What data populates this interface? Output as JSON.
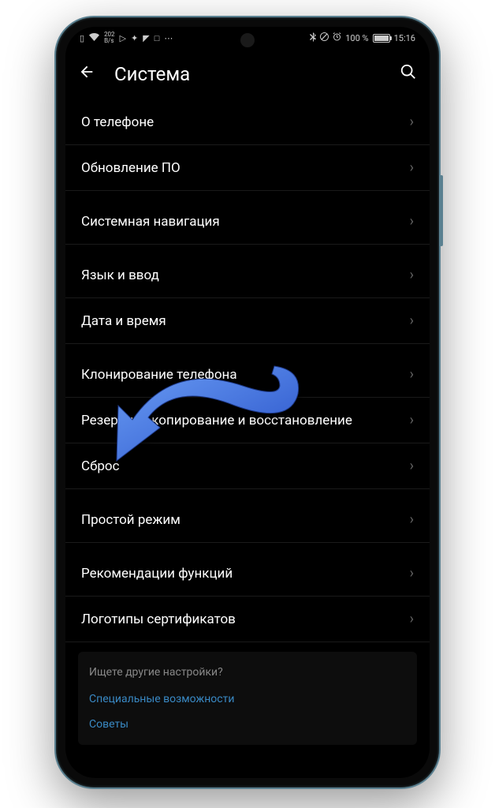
{
  "status_bar": {
    "speed": "202",
    "speed_unit": "B/s",
    "battery_percent": "100 %",
    "time": "15:16"
  },
  "header": {
    "title": "Система"
  },
  "sections": [
    {
      "items": [
        {
          "label": "О телефоне"
        },
        {
          "label": "Обновление ПО"
        }
      ]
    },
    {
      "items": [
        {
          "label": "Системная навигация"
        }
      ]
    },
    {
      "items": [
        {
          "label": "Язык и ввод"
        },
        {
          "label": "Дата и время"
        }
      ]
    },
    {
      "items": [
        {
          "label": "Клонирование телефона"
        },
        {
          "label": "Резервное копирование и восстановление"
        },
        {
          "label": "Сброс"
        }
      ]
    },
    {
      "items": [
        {
          "label": "Простой режим"
        }
      ]
    },
    {
      "items": [
        {
          "label": "Рекомендации функций"
        },
        {
          "label": "Логотипы сертификатов"
        }
      ]
    }
  ],
  "more_settings": {
    "title": "Ищете другие настройки?",
    "links": [
      {
        "label": "Специальные возможности"
      },
      {
        "label": "Советы"
      }
    ]
  }
}
